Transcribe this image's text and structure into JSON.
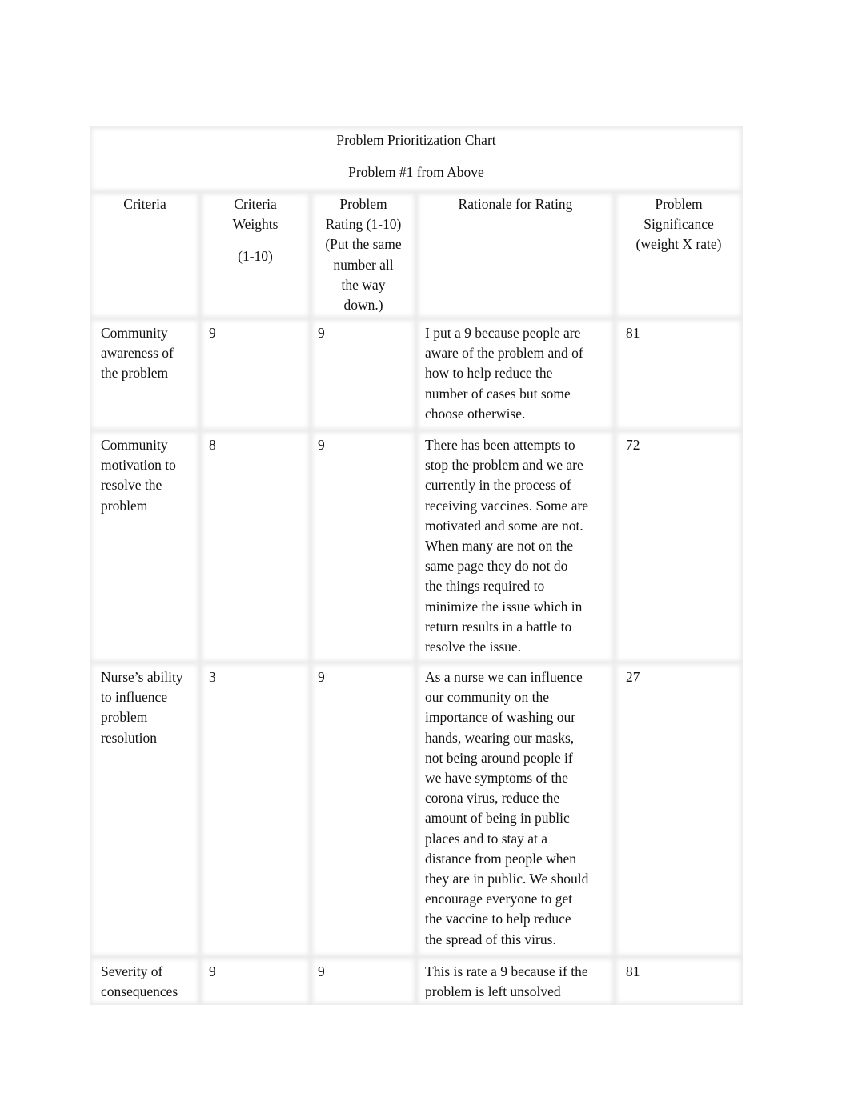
{
  "document": {
    "title": "Problem Prioritization Chart",
    "subtitle": "Problem #1 from Above",
    "headers": {
      "criteria": "Criteria",
      "weights_lines": [
        "Criteria",
        "Weights",
        "",
        "(1-10)"
      ],
      "rating_lines": [
        "Problem",
        "Rating (1-10)",
        "(Put the same",
        "number all",
        "the way",
        "down.)"
      ],
      "rationale": "Rationale for Rating",
      "significance_lines": [
        "Problem",
        "Significance",
        "(weight X rate)"
      ]
    },
    "rows": [
      {
        "criteria_lines": [
          "Community",
          "awareness of",
          "the problem"
        ],
        "weight": "9",
        "rating": "9",
        "rationale_lines": [
          "I put a 9 because people are",
          "aware of the problem and of",
          "how to help reduce the",
          "number of cases but some",
          "choose otherwise."
        ],
        "significance": "81"
      },
      {
        "criteria_lines": [
          "Community",
          "motivation to",
          "resolve the",
          "problem"
        ],
        "weight": "8",
        "rating": "9",
        "rationale_lines": [
          "There has been attempts to",
          "stop the problem and we are",
          "currently in the process of",
          "receiving vaccines. Some are",
          "motivated and some are not.",
          "When many are not on the",
          "same page they do not do",
          "the things required to",
          "minimize the issue which in",
          "return results in a battle to",
          "resolve the issue."
        ],
        "significance": "72"
      },
      {
        "criteria_lines": [
          "Nurse’s ability",
          "to influence",
          "problem",
          "resolution"
        ],
        "weight": "3",
        "rating": "9",
        "rationale_lines": [
          "As a nurse we can influence",
          "our community on the",
          "importance of washing our",
          "hands, wearing our masks,",
          "not being around people if",
          "we have symptoms of the",
          "corona virus, reduce the",
          "amount of being in public",
          "places and to stay at a",
          "distance from people when",
          "they are in public.  We should",
          "encourage everyone to get",
          "the vaccine to help reduce",
          "the spread of this virus."
        ],
        "significance": "27"
      },
      {
        "criteria_lines": [
          "Severity of",
          "consequences"
        ],
        "weight": "9",
        "rating": "9",
        "rationale_lines": [
          "This is rate a 9 because if the",
          "problem is left unsolved"
        ],
        "significance": "81"
      }
    ]
  }
}
